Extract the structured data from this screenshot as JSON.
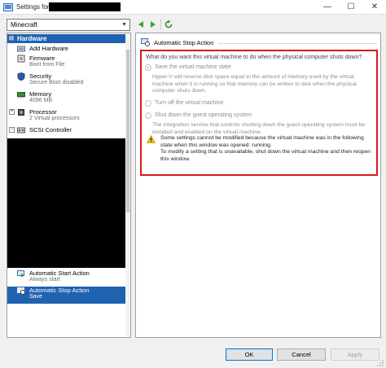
{
  "window": {
    "title_prefix": "Settings for",
    "minimize": "—",
    "maximize": "☐",
    "close": "✕"
  },
  "vm_selector": {
    "value": "Minecraft"
  },
  "tree": {
    "header": "Hardware",
    "items": [
      {
        "label": "Add Hardware",
        "sub": ""
      },
      {
        "label": "Firmware",
        "sub": "Boot from File"
      },
      {
        "label": "Security",
        "sub": "Secure Boot disabled"
      },
      {
        "label": "Memory",
        "sub": "4096 MB"
      },
      {
        "label": "Processor",
        "sub": "2 Virtual processors"
      },
      {
        "label": "SCSI Controller",
        "sub": ""
      },
      {
        "label": "Automatic Start Action",
        "sub": "Always start"
      },
      {
        "label": "Automatic Stop Action",
        "sub": "Save"
      }
    ]
  },
  "section": {
    "title": "Automatic Stop Action",
    "question": "What do you want this virtual machine to do when the physical computer shuts down?",
    "options": [
      {
        "label": "Save the virtual machine state",
        "selected": true
      },
      {
        "label": "Turn off the virtual machine",
        "selected": false
      },
      {
        "label": "Shut down the guest operating system",
        "selected": false
      }
    ],
    "save_desc": "Hyper-V will reserve disk space equal to the amount of memory used by the virtual machine when it is running so that memory can be written to disk when the physical computer shuts down.",
    "shutdown_desc": "The integration service that controls shutting down the guest operating system must be installed and enabled on the virtual machine.",
    "warning_line1": "Some settings cannot be modified because the virtual machine was in the following state when this window was opened: running.",
    "warning_line2": "To modify a setting that is unavailable, shut down the virtual machine and then reopen this window."
  },
  "buttons": {
    "ok": "OK",
    "cancel": "Cancel",
    "apply": "Apply"
  },
  "colors": {
    "accent": "#1e62b0",
    "highlight_border": "#d51b1b",
    "nav_arrow": "#3aa03a"
  }
}
